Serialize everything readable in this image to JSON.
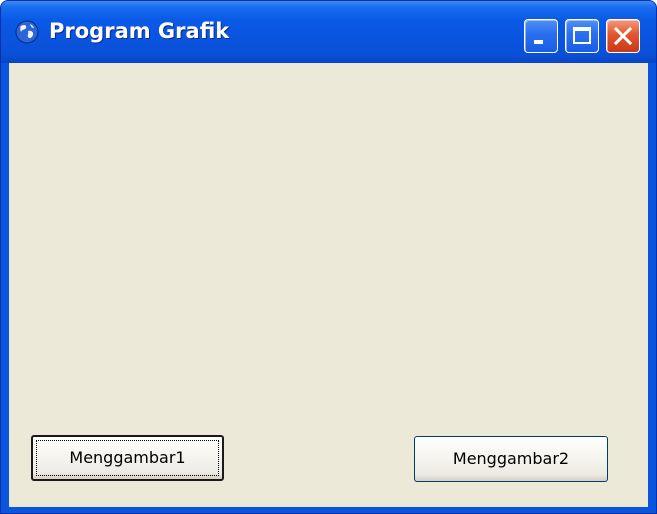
{
  "window": {
    "title": "Program Grafik",
    "app_icon": "globe-icon",
    "controls": {
      "minimize_icon": "minimize-icon",
      "maximize_icon": "maximize-icon",
      "close_icon": "close-icon"
    }
  },
  "buttons": {
    "button1_label": "Menggambar1",
    "button2_label": "Menggambar2"
  },
  "colors": {
    "titlebar": "#0a55e0",
    "client_background": "#ece9d8",
    "close_button": "#e2562f"
  }
}
